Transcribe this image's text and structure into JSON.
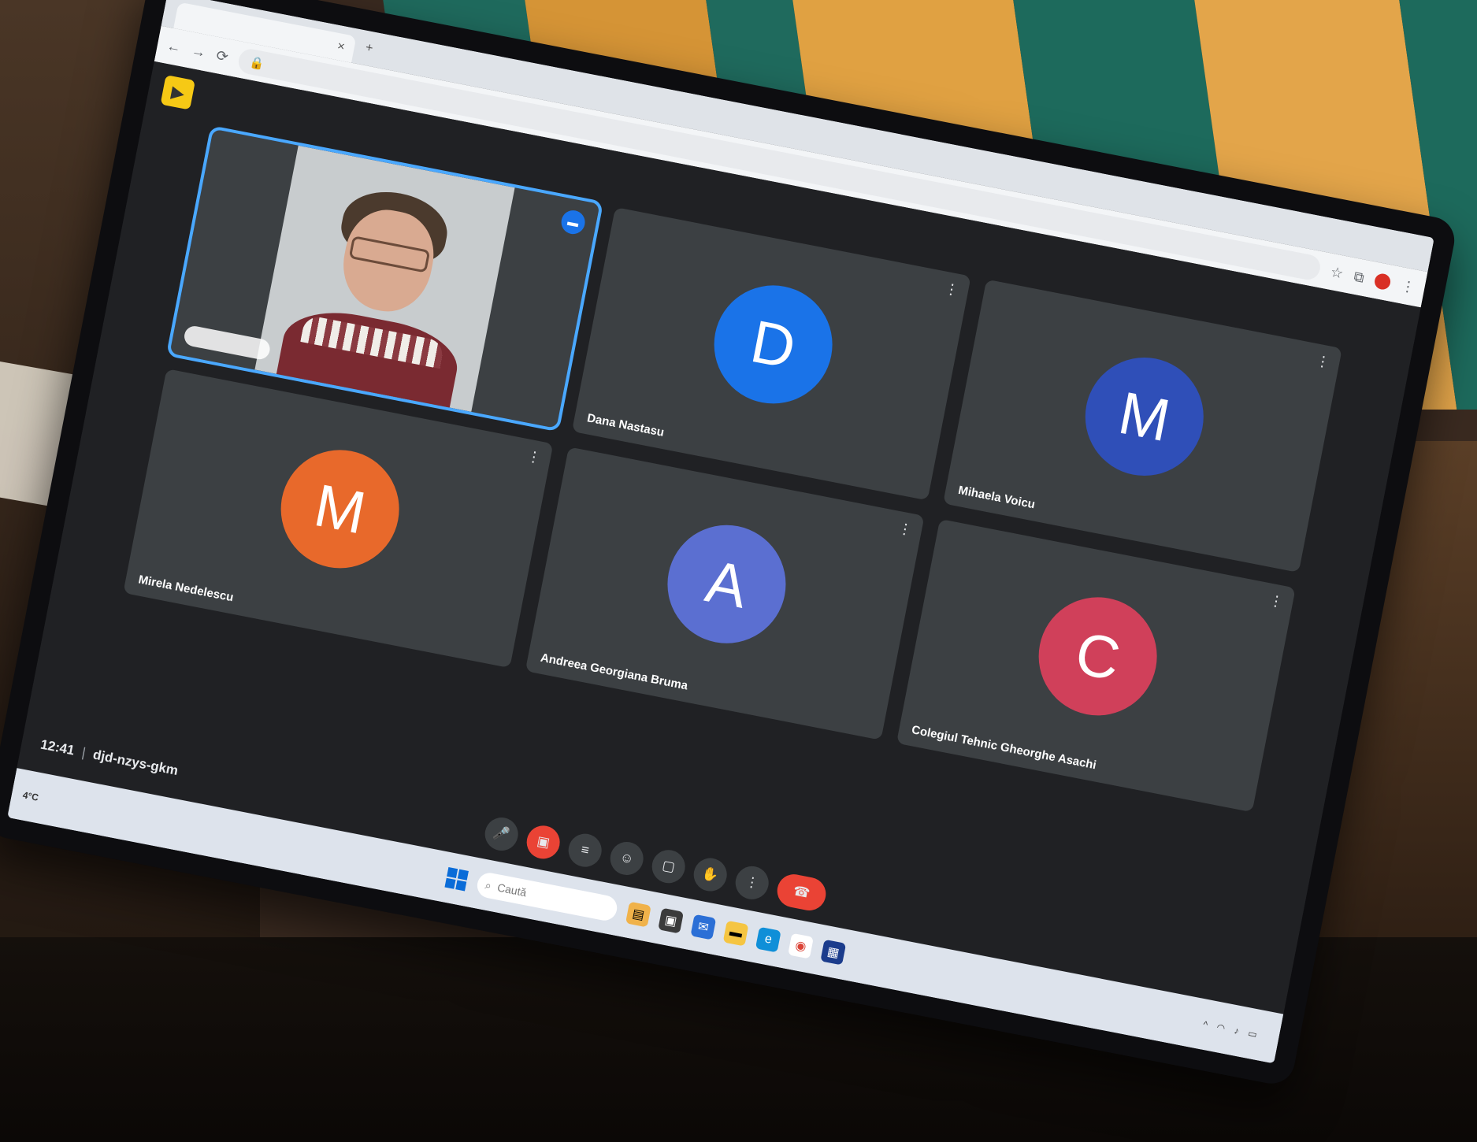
{
  "browser": {
    "tab_title": "",
    "url": ""
  },
  "meet": {
    "logo_glyph": "▶",
    "meeting_time": "12:41",
    "meeting_code": "djd-nzys-gkm",
    "self_tile": {
      "name": "",
      "speaking_icon": "speaking-indicator-icon"
    },
    "participants": [
      {
        "initial": "D",
        "name": "Dana Nastasu",
        "color": "#1a73e8"
      },
      {
        "initial": "M",
        "name": "Mirela Nedelescu",
        "color": "#e8692b"
      },
      {
        "initial": "M",
        "name": "Mihaela Voicu",
        "color": "#2f4fb8"
      },
      {
        "initial": "A",
        "name": "Andreea Georgiana Bruma",
        "color": "#5b6fd1"
      },
      {
        "initial": "C",
        "name": "Colegiul Tehnic Gheorghe Asachi",
        "color": "#d0405a"
      }
    ],
    "controls": [
      {
        "icon": "microphone-icon",
        "glyph": "🎤"
      },
      {
        "icon": "camera-off-icon",
        "glyph": "▣"
      },
      {
        "icon": "captions-icon",
        "glyph": "≡"
      },
      {
        "icon": "emoji-icon",
        "glyph": "☺"
      },
      {
        "icon": "present-screen-icon",
        "glyph": "▢"
      },
      {
        "icon": "raise-hand-icon",
        "glyph": "✋"
      },
      {
        "icon": "more-options-icon",
        "glyph": "⋮"
      },
      {
        "icon": "leave-call-icon",
        "glyph": "☎"
      }
    ]
  },
  "taskbar": {
    "weather_temp": "4°C",
    "weather_desc": "",
    "search_placeholder": "Caută",
    "clock_time": "",
    "clock_date": ""
  },
  "colors": {
    "accent": "#4aa8ff",
    "tile": "#3c4043",
    "meet_bg": "#202124",
    "end_call": "#ea4335"
  }
}
